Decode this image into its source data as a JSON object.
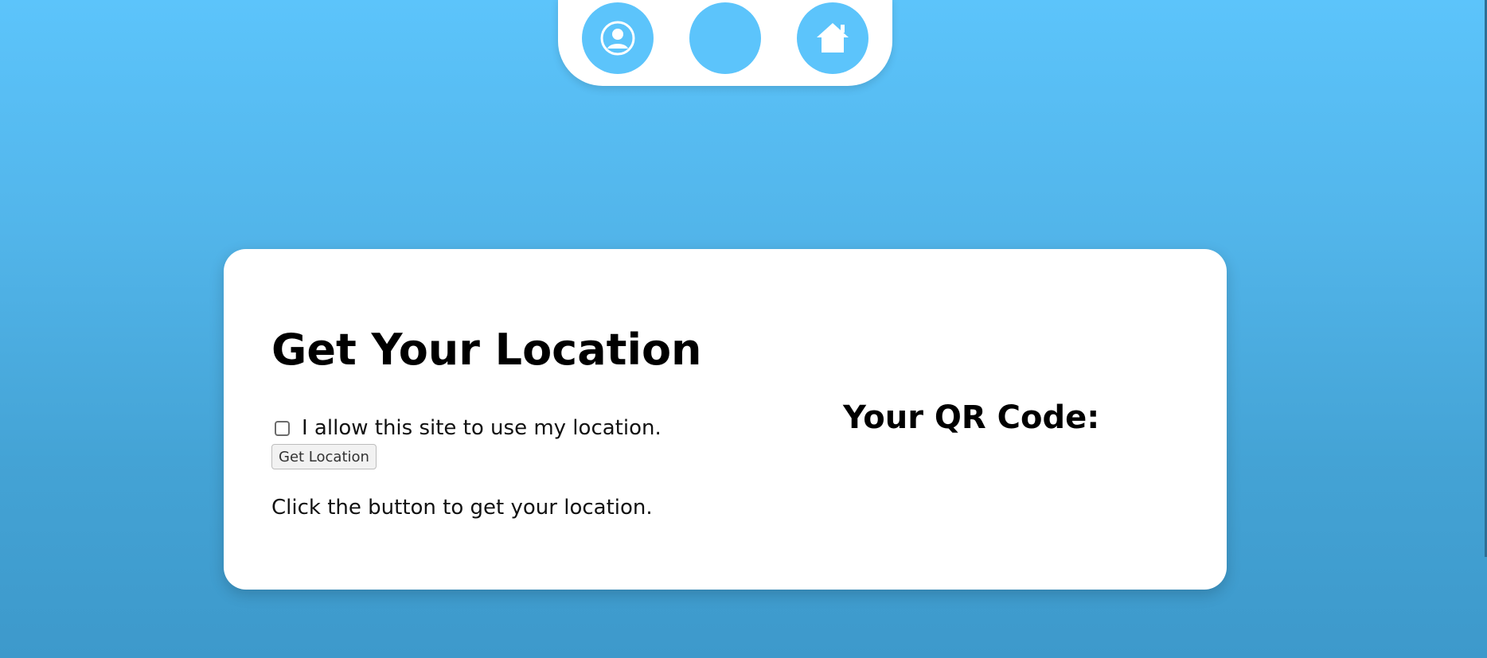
{
  "nav": {
    "items": [
      {
        "name": "profile",
        "icon": "user-circle-icon"
      },
      {
        "name": "blank",
        "icon": ""
      },
      {
        "name": "home",
        "icon": "home-icon"
      }
    ]
  },
  "card": {
    "title": "Get Your Location",
    "consent_label": "I allow this site to use my location.",
    "consent_checked": false,
    "get_location_label": "Get Location",
    "status_text": "Click the button to get your location.",
    "qr_heading": "Your QR Code:"
  },
  "colors": {
    "accent": "#5cc4fb",
    "card_bg": "#ffffff"
  }
}
